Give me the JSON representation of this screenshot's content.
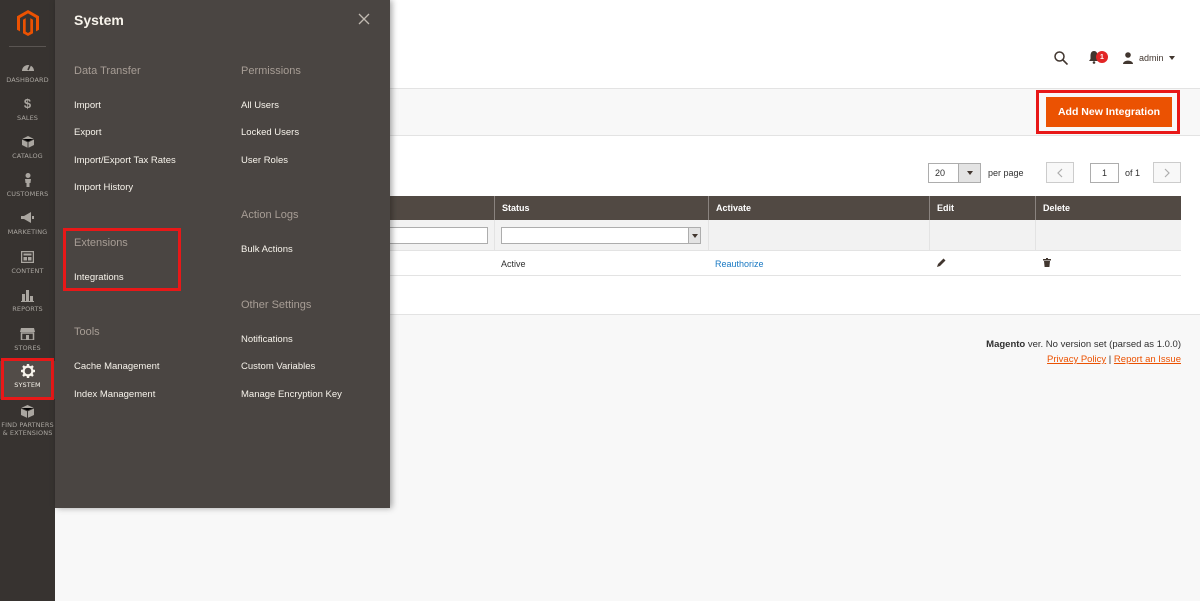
{
  "nav": {
    "items": [
      {
        "label": "DASHBOARD",
        "icon": "dashboard-icon"
      },
      {
        "label": "SALES",
        "icon": "dollar-icon"
      },
      {
        "label": "CATALOG",
        "icon": "box-icon"
      },
      {
        "label": "CUSTOMERS",
        "icon": "person-icon"
      },
      {
        "label": "MARKETING",
        "icon": "megaphone-icon"
      },
      {
        "label": "CONTENT",
        "icon": "layout-icon"
      },
      {
        "label": "REPORTS",
        "icon": "bar-chart-icon"
      },
      {
        "label": "STORES",
        "icon": "store-icon"
      },
      {
        "label": "SYSTEM",
        "icon": "gear-icon"
      },
      {
        "label_line1": "FIND PARTNERS",
        "label_line2": "& EXTENSIONS",
        "icon": "cube-icon"
      }
    ]
  },
  "flyout": {
    "title": "System",
    "groups": {
      "data_transfer": {
        "title": "Data Transfer",
        "links": [
          "Import",
          "Export",
          "Import/Export Tax Rates",
          "Import History"
        ]
      },
      "extensions": {
        "title": "Extensions",
        "links": [
          "Integrations"
        ]
      },
      "tools": {
        "title": "Tools",
        "links": [
          "Cache Management",
          "Index Management"
        ]
      },
      "permissions": {
        "title": "Permissions",
        "links": [
          "All Users",
          "Locked Users",
          "User Roles"
        ]
      },
      "action_logs": {
        "title": "Action Logs",
        "links": [
          "Bulk Actions"
        ]
      },
      "other_settings": {
        "title": "Other Settings",
        "links": [
          "Notifications",
          "Custom Variables",
          "Manage Encryption Key"
        ]
      }
    }
  },
  "header": {
    "notifications_count": "1",
    "user_name": "admin"
  },
  "actions": {
    "add_new": "Add New Integration"
  },
  "pager": {
    "per_page_value": "20",
    "per_page_label": "per page",
    "current_page": "1",
    "of_label": "of 1"
  },
  "grid": {
    "columns": [
      "Status",
      "Activate",
      "Edit",
      "Delete"
    ],
    "rows": [
      {
        "status": "Active",
        "activate": "Reauthorize"
      }
    ]
  },
  "footer": {
    "brand": "Magento",
    "version_text": " ver. No version set (parsed as 1.0.0)",
    "privacy": "Privacy Policy",
    "separator": " | ",
    "report": "Report an Issue"
  },
  "colors": {
    "accent": "#eb5202",
    "nav_bg": "#373330",
    "flyout_bg": "#4a4542",
    "highlight": "#e81818",
    "grid_header": "#514943"
  }
}
